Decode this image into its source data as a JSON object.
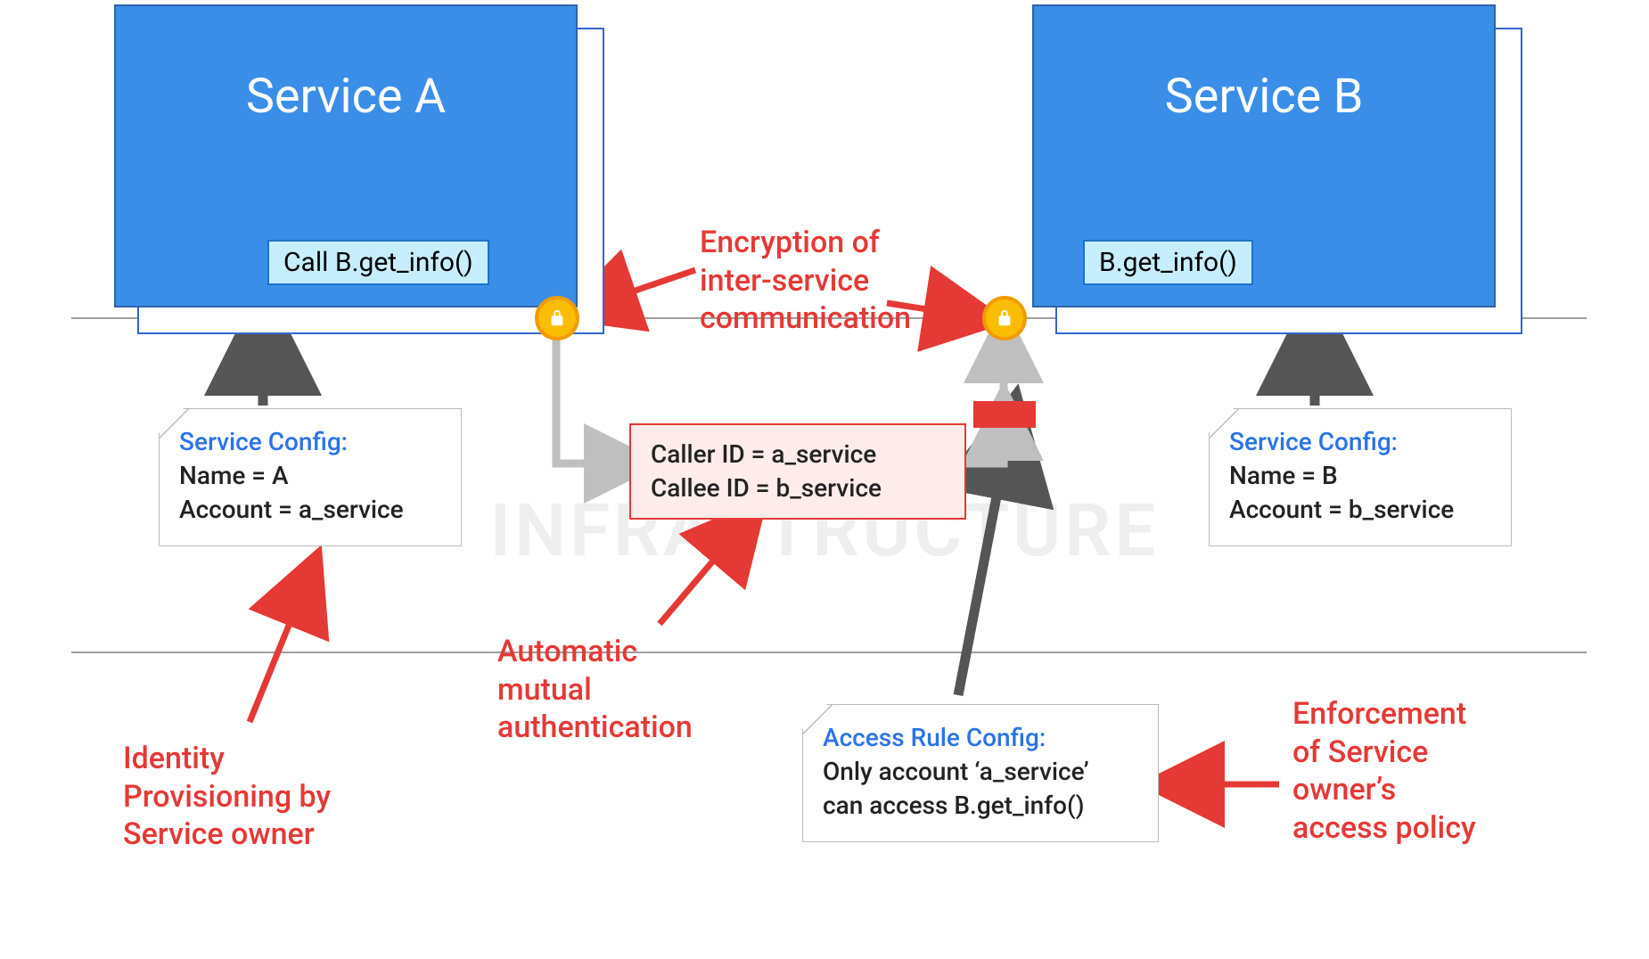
{
  "watermark": "INFRASTRUCTURE",
  "service_a": {
    "title": "Service A",
    "call_box": "Call B.get_info()"
  },
  "service_b": {
    "title": "Service B",
    "call_box": "B.get_info()"
  },
  "encryption_label": "Encryption of\ninter-service\ncommunication",
  "id_box": {
    "line1": "Caller  ID = a_service",
    "line2": "Callee ID =  b_service"
  },
  "auto_mutual_label": "Automatic\nmutual\nauthentication",
  "identity_label": "Identity\nProvisioning by\nService owner",
  "config_a": {
    "title": "Service Config:",
    "line1": "Name = A",
    "line2": "Account  = a_service"
  },
  "config_b": {
    "title": "Service Config:",
    "line1": "Name = B",
    "line2": "Account  = b_service"
  },
  "access_rule": {
    "title": "Access Rule Config:",
    "line1": "Only account ‘a_service’",
    "line2": "can access B.get_info()"
  },
  "enforcement_label": "Enforcement\nof Service\nowner’s\naccess policy"
}
